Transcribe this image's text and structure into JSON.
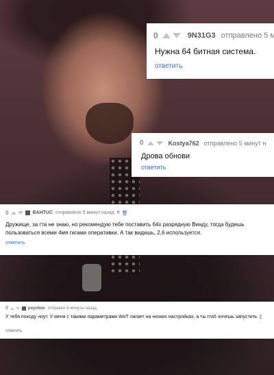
{
  "comments": [
    {
      "score": "0",
      "author": "9N31G3",
      "sent": "отправлено 5 м",
      "text": "Нужна 64 битная система.",
      "reply": "ответить"
    },
    {
      "score": "0",
      "author": "Kostya762",
      "sent": "отправлено 5 минут н",
      "text": "Дрова обнови",
      "reply": "ответить"
    },
    {
      "score": "0",
      "author": "BAHTUC",
      "sent": "отправлено 5 минут назад",
      "text": "Дружище, за гта не знаю, но рекомендую тебе поставить 64х разрядную Винду, тогда будешь пользоваться всеми 4мя гигами оперативки. А так видишь, 2,6 используется.",
      "reply": "ответить"
    },
    {
      "score": "0",
      "author": "psychoo",
      "sent": "отправил 4 минуты назад",
      "text": "У тебя походу ноут. У меня с такими параметрами WoT лагает на низких настройках, а ты гта5 хочешь запустить :)",
      "reply": "ответить"
    }
  ],
  "colors": {
    "reply_link": "#3b6fb6",
    "vote_arrow": "#c4c4c4",
    "card_bg": "#ffffff"
  },
  "icons": {
    "vote_up": "arrow-up-icon",
    "vote_down": "arrow-down-icon",
    "permalink": "link-icon",
    "delete": "trash-icon"
  }
}
